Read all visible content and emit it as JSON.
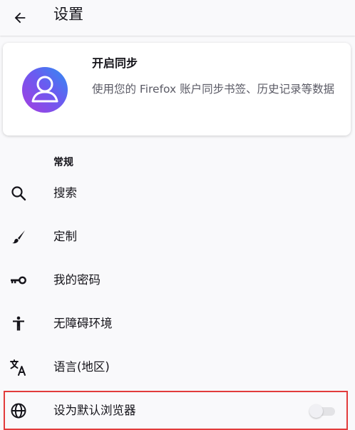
{
  "header": {
    "title": "设置",
    "back_icon": "arrow-back-icon"
  },
  "sync_card": {
    "title": "开启同步",
    "description": "使用您的 Firefox 账户同步书签、历史记录等数据",
    "avatar_icon": "account-avatar-icon",
    "avatar_gradient": [
      "#7542e5",
      "#0090ed"
    ]
  },
  "general": {
    "header": "常规",
    "items": [
      {
        "label": "搜索",
        "icon": "search-icon"
      },
      {
        "label": "定制",
        "icon": "paintbrush-icon"
      },
      {
        "label": "我的密码",
        "icon": "key-icon"
      },
      {
        "label": "无障碍环境",
        "icon": "accessibility-icon"
      },
      {
        "label": "语言(地区)",
        "icon": "translate-icon"
      },
      {
        "label": "设为默认浏览器",
        "icon": "globe-icon",
        "toggle": false
      }
    ]
  },
  "colors": {
    "highlight_border": "#e23b3b",
    "toggle_off_track": "#e3e3e6"
  }
}
